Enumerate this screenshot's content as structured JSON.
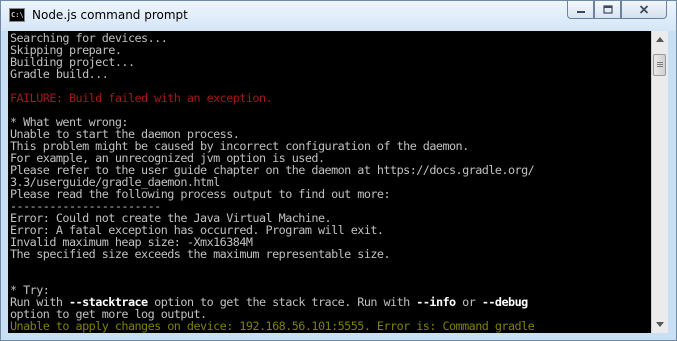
{
  "window": {
    "title": "Node.js command prompt",
    "icon_text": "C:\\."
  },
  "console": {
    "lines": [
      {
        "text": "Searching for devices...",
        "color": "default"
      },
      {
        "text": "Skipping prepare.",
        "color": "default"
      },
      {
        "text": "Building project...",
        "color": "default"
      },
      {
        "text": "Gradle build...",
        "color": "default"
      },
      {
        "text": "",
        "color": "default"
      },
      {
        "text": "FAILURE: Build failed with an exception.",
        "color": "red"
      },
      {
        "text": "",
        "color": "default"
      },
      {
        "text": "* What went wrong:",
        "color": "default"
      },
      {
        "text": "Unable to start the daemon process.",
        "color": "default"
      },
      {
        "text": "This problem might be caused by incorrect configuration of the daemon.",
        "color": "default"
      },
      {
        "text": "For example, an unrecognized jvm option is used.",
        "color": "default"
      },
      {
        "text": "Please refer to the user guide chapter on the daemon at https://docs.gradle.org/",
        "color": "default"
      },
      {
        "text": "3.3/userguide/gradle_daemon.html",
        "color": "default"
      },
      {
        "text": "Please read the following process output to find out more:",
        "color": "default"
      },
      {
        "text": "-----------------------",
        "color": "default"
      },
      {
        "text": "Error: Could not create the Java Virtual Machine.",
        "color": "default"
      },
      {
        "text": "Error: A fatal exception has occurred. Program will exit.",
        "color": "default"
      },
      {
        "text": "Invalid maximum heap size: -Xmx16384M",
        "color": "default"
      },
      {
        "text": "The specified size exceeds the maximum representable size.",
        "color": "default"
      },
      {
        "text": "",
        "color": "default"
      },
      {
        "text": "",
        "color": "default"
      },
      {
        "text": "* Try:",
        "color": "default"
      },
      {
        "segments": [
          {
            "text": "Run with ",
            "bold": false
          },
          {
            "text": "--stacktrace",
            "bold": true
          },
          {
            "text": " option to get the stack trace. Run with ",
            "bold": false
          },
          {
            "text": "--info",
            "bold": true
          },
          {
            "text": " or ",
            "bold": false
          },
          {
            "text": "--debug",
            "bold": true
          }
        ],
        "color": "default"
      },
      {
        "text": "option to get more log output.",
        "color": "default"
      },
      {
        "text": "Unable to apply changes on device: 192.168.56.101:5555. Error is: Command gradle",
        "color": "yellow"
      }
    ]
  },
  "colors": {
    "console_bg": "#000000",
    "default": "#c0c0c0",
    "red": "#a4171a",
    "yellow": "#808000",
    "bold": "#ffffff"
  }
}
